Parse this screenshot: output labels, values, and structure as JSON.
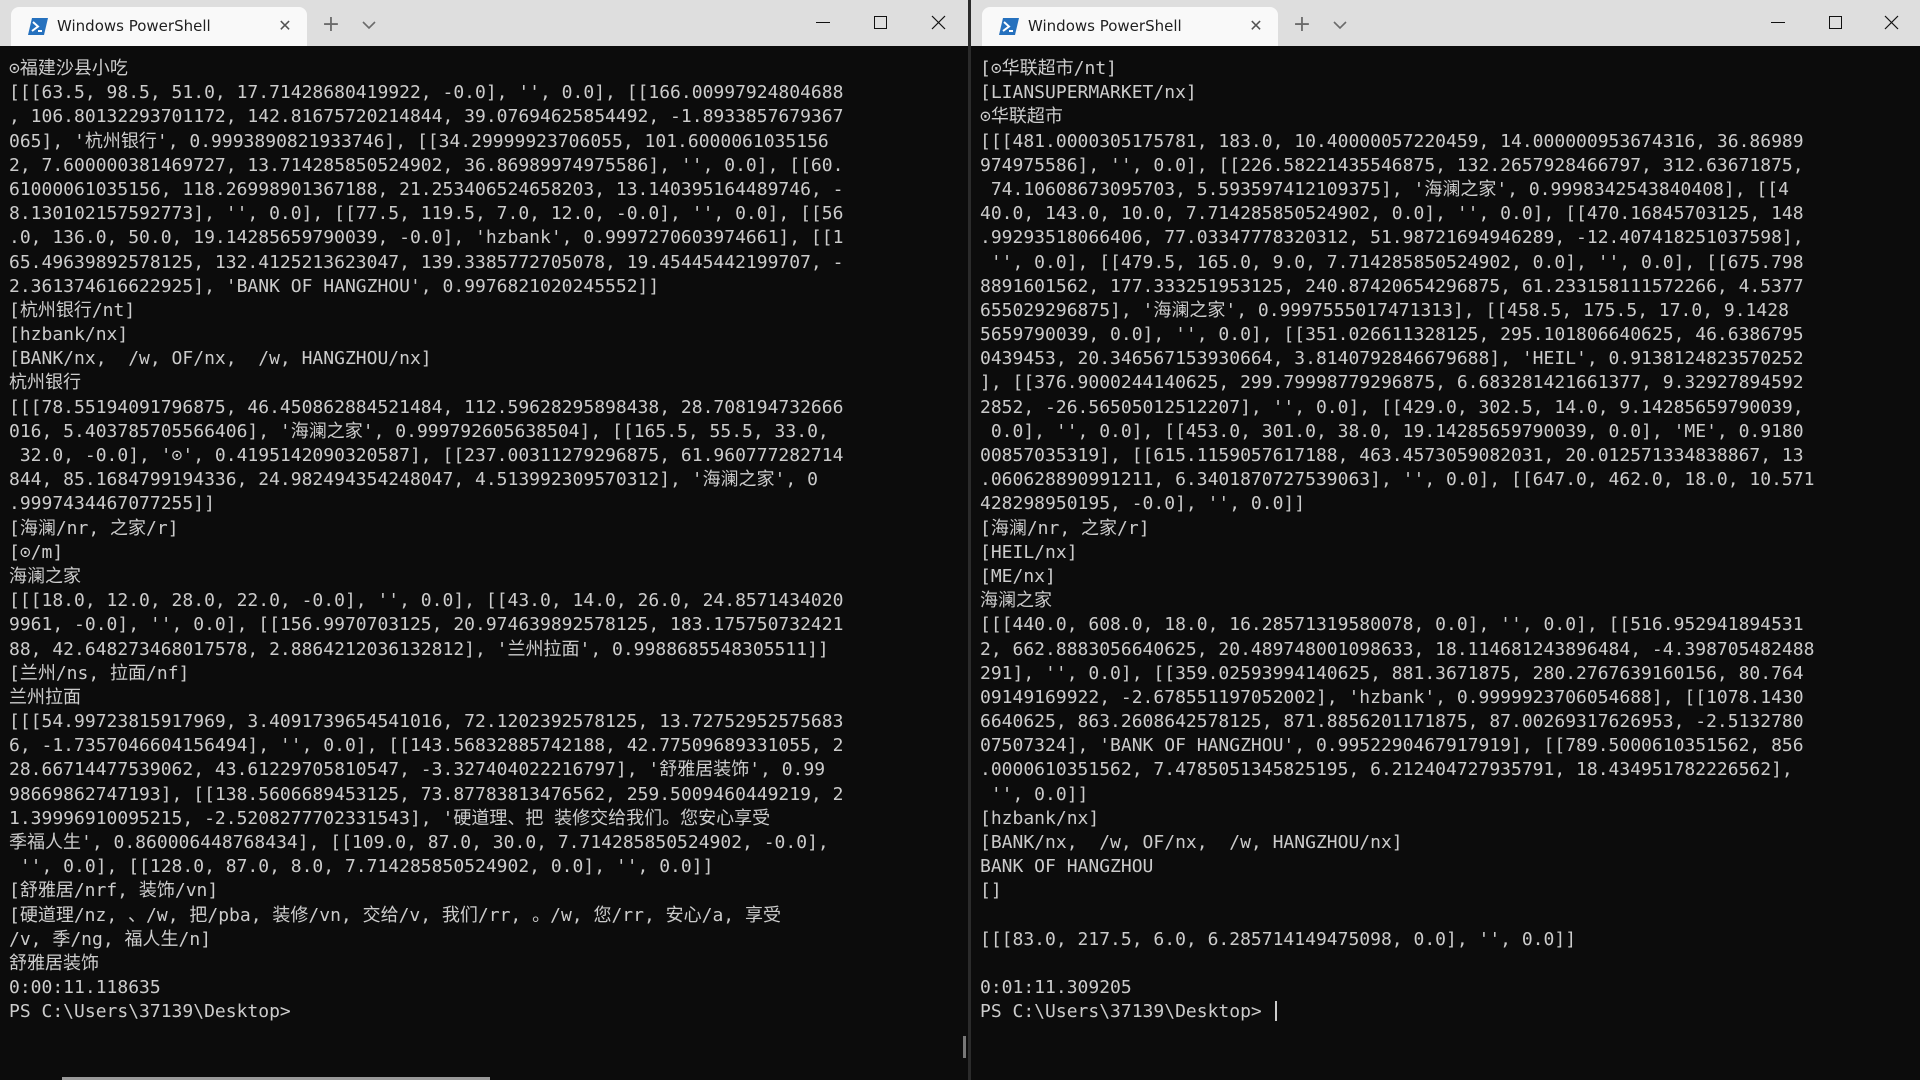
{
  "left": {
    "tab_title": "Windows PowerShell",
    "lines": [
      "⊙福建沙县小吃",
      "[[[63.5, 98.5, 51.0, 17.71428680419922, -0.0], '', 0.0], [[166.00997924804688",
      ", 106.80132293701172, 142.81675720214844, 39.07694625854492, -1.8933857679367",
      "065], '杭州银行', 0.9993890821933746], [[34.29999923706055, 101.6000061035156",
      "2, 7.600000381469727, 13.714285850524902, 36.86989974975586], '', 0.0], [[60.",
      "61000061035156, 118.26998901367188, 21.253406524658203, 13.140395164489746, -",
      "8.130102157592773], '', 0.0], [[77.5, 119.5, 7.0, 12.0, -0.0], '', 0.0], [[56",
      ".0, 136.0, 50.0, 19.14285659790039, -0.0], 'hzbank', 0.9997270603974661], [[1",
      "65.49639892578125, 132.4125213623047, 139.3385772705078, 19.45445442199707, -",
      "2.361374616622925], 'BANK OF HANGZHOU', 0.9976821020245552]]",
      "[杭州银行/nt]",
      "[hzbank/nx]",
      "[BANK/nx,  /w, OF/nx,  /w, HANGZHOU/nx]",
      "杭州银行",
      "[[[78.55194091796875, 46.450862884521484, 112.59628295898438, 28.708194732666",
      "016, 5.403785705566406], '海澜之家', 0.999792605638504], [[165.5, 55.5, 33.0,",
      " 32.0, -0.0], '⊙', 0.4195142090320587], [[237.00311279296875, 61.960777282714",
      "844, 85.1684799194336, 24.982494354248047, 4.513992309570312], '海澜之家', 0",
      ".9997434467077255]]",
      "[海澜/nr, 之家/r]",
      "[⊙/m]",
      "海澜之家",
      "[[[18.0, 12.0, 28.0, 22.0, -0.0], '', 0.0], [[43.0, 14.0, 26.0, 24.8571434020",
      "9961, -0.0], '', 0.0], [[156.9970703125, 20.974639892578125, 183.175750732421",
      "88, 42.648273468017578, 2.8864212036132812], '兰州拉面', 0.9988685548305511]]",
      "[兰州/ns, 拉面/nf]",
      "兰州拉面",
      "[[[54.99723815917969, 3.4091739654541016, 72.1202392578125, 13.72752952575683",
      "6, -1.7357046604156494], '', 0.0], [[143.56832885742188, 42.77509689331055, 2",
      "28.66714477539062, 43.61229705810547, -3.327404022216797], '舒雅居装饰', 0.99",
      "98669862747193], [[138.5606689453125, 73.87783813476562, 259.5009460449219, 2",
      "1.39996910095215, -2.5208277702331543], '硬道理、把 装修交给我们。您安心享受",
      "季福人生', 0.860006448768434], [[109.0, 87.0, 30.0, 7.714285850524902, -0.0],",
      " '', 0.0], [[128.0, 87.0, 8.0, 7.714285850524902, 0.0], '', 0.0]]",
      "[舒雅居/nrf, 装饰/vn]",
      "[硬道理/nz, 、/w, 把/pba, 装修/vn, 交给/v, 我们/rr, 。/w, 您/rr, 安心/a, 享受",
      "/v, 季/ng, 福人生/n]",
      "舒雅居装饰",
      "0:00:11.118635",
      "PS C:\\Users\\37139\\Desktop>"
    ]
  },
  "right": {
    "tab_title": "Windows PowerShell",
    "lines": [
      "[⊙华联超市/nt]",
      "[LIANSUPERMARKET/nx]",
      "⊙华联超市",
      "[[[481.0000305175781, 183.0, 10.40000057220459, 14.000000953674316, 36.86989",
      "974975586], '', 0.0], [[226.58221435546875, 132.2657928466797, 312.63671875,",
      " 74.10608673095703, 5.593597412109375], '海澜之家', 0.9998342543840408], [[4",
      "40.0, 143.0, 10.0, 7.714285850524902, 0.0], '', 0.0], [[470.16845703125, 148",
      ".99293518066406, 77.03347778320312, 51.98721694946289, -12.407418251037598],",
      " '', 0.0], [[479.5, 165.0, 9.0, 7.714285850524902, 0.0], '', 0.0], [[675.798",
      "8891601562, 177.333251953125, 240.87420654296875, 61.233158111572266, 4.5377",
      "655029296875], '海澜之家', 0.9997555017471313], [[458.5, 175.5, 17.0, 9.1428",
      "5659790039, 0.0], '', 0.0], [[351.026611328125, 295.101806640625, 46.6386795",
      "0439453, 20.346567153930664, 3.8140792846679688], 'HEIL', 0.9138124823570252",
      "], [[376.9000244140625, 299.79998779296875, 6.683281421661377, 9.32927894592",
      "2852, -26.56505012512207], '', 0.0], [[429.0, 302.5, 14.0, 9.14285659790039,",
      " 0.0], '', 0.0], [[453.0, 301.0, 38.0, 19.14285659790039, 0.0], 'ME', 0.9180",
      "00857035319], [[615.1159057617188, 463.4573059082031, 20.012571334838867, 13",
      ".060628890991211, 6.3401870727539063], '', 0.0], [[647.0, 462.0, 18.0, 10.571",
      "428298950195, -0.0], '', 0.0]]",
      "[海澜/nr, 之家/r]",
      "[HEIL/nx]",
      "[ME/nx]",
      "海澜之家",
      "[[[440.0, 608.0, 18.0, 16.28571319580078, 0.0], '', 0.0], [[516.952941894531",
      "2, 662.8883056640625, 20.489748001098633, 18.114681243896484, -4.398705482488",
      "291], '', 0.0], [[359.02593994140625, 881.3671875, 280.2767639160156, 80.764",
      "09149169922, -2.678551197052002], 'hzbank', 0.9999923706054688], [[1078.1430",
      "6640625, 863.2608642578125, 871.8856201171875, 87.00269317626953, -2.5132780",
      "07507324], 'BANK OF HANGZHOU', 0.9952290467917919], [[789.5000610351562, 856",
      ".0000610351562, 7.4785051345825195, 6.212404727935791, 18.434951782226562],",
      " '', 0.0]]",
      "[hzbank/nx]",
      "[BANK/nx,  /w, OF/nx,  /w, HANGZHOU/nx]",
      "BANK OF HANGZHOU",
      "[]",
      "",
      "[[[83.0, 217.5, 6.0, 6.285714149475098, 0.0], '', 0.0]]",
      "",
      "0:01:11.309205",
      "PS C:\\Users\\37139\\Desktop>"
    ]
  },
  "icons": {
    "tab": "powershell-icon",
    "close": "close-icon",
    "new_tab": "plus-icon",
    "dropdown": "chevron-down-icon",
    "minimize": "minimize-icon",
    "maximize": "maximize-icon",
    "window_close": "window-close-icon"
  },
  "colors": {
    "terminal_bg": "#0c0c0c",
    "terminal_fg": "#cccccc",
    "titlebar_bg": "#dedede",
    "tab_bg": "#f9f9f9",
    "ps_icon": "#2671be"
  }
}
